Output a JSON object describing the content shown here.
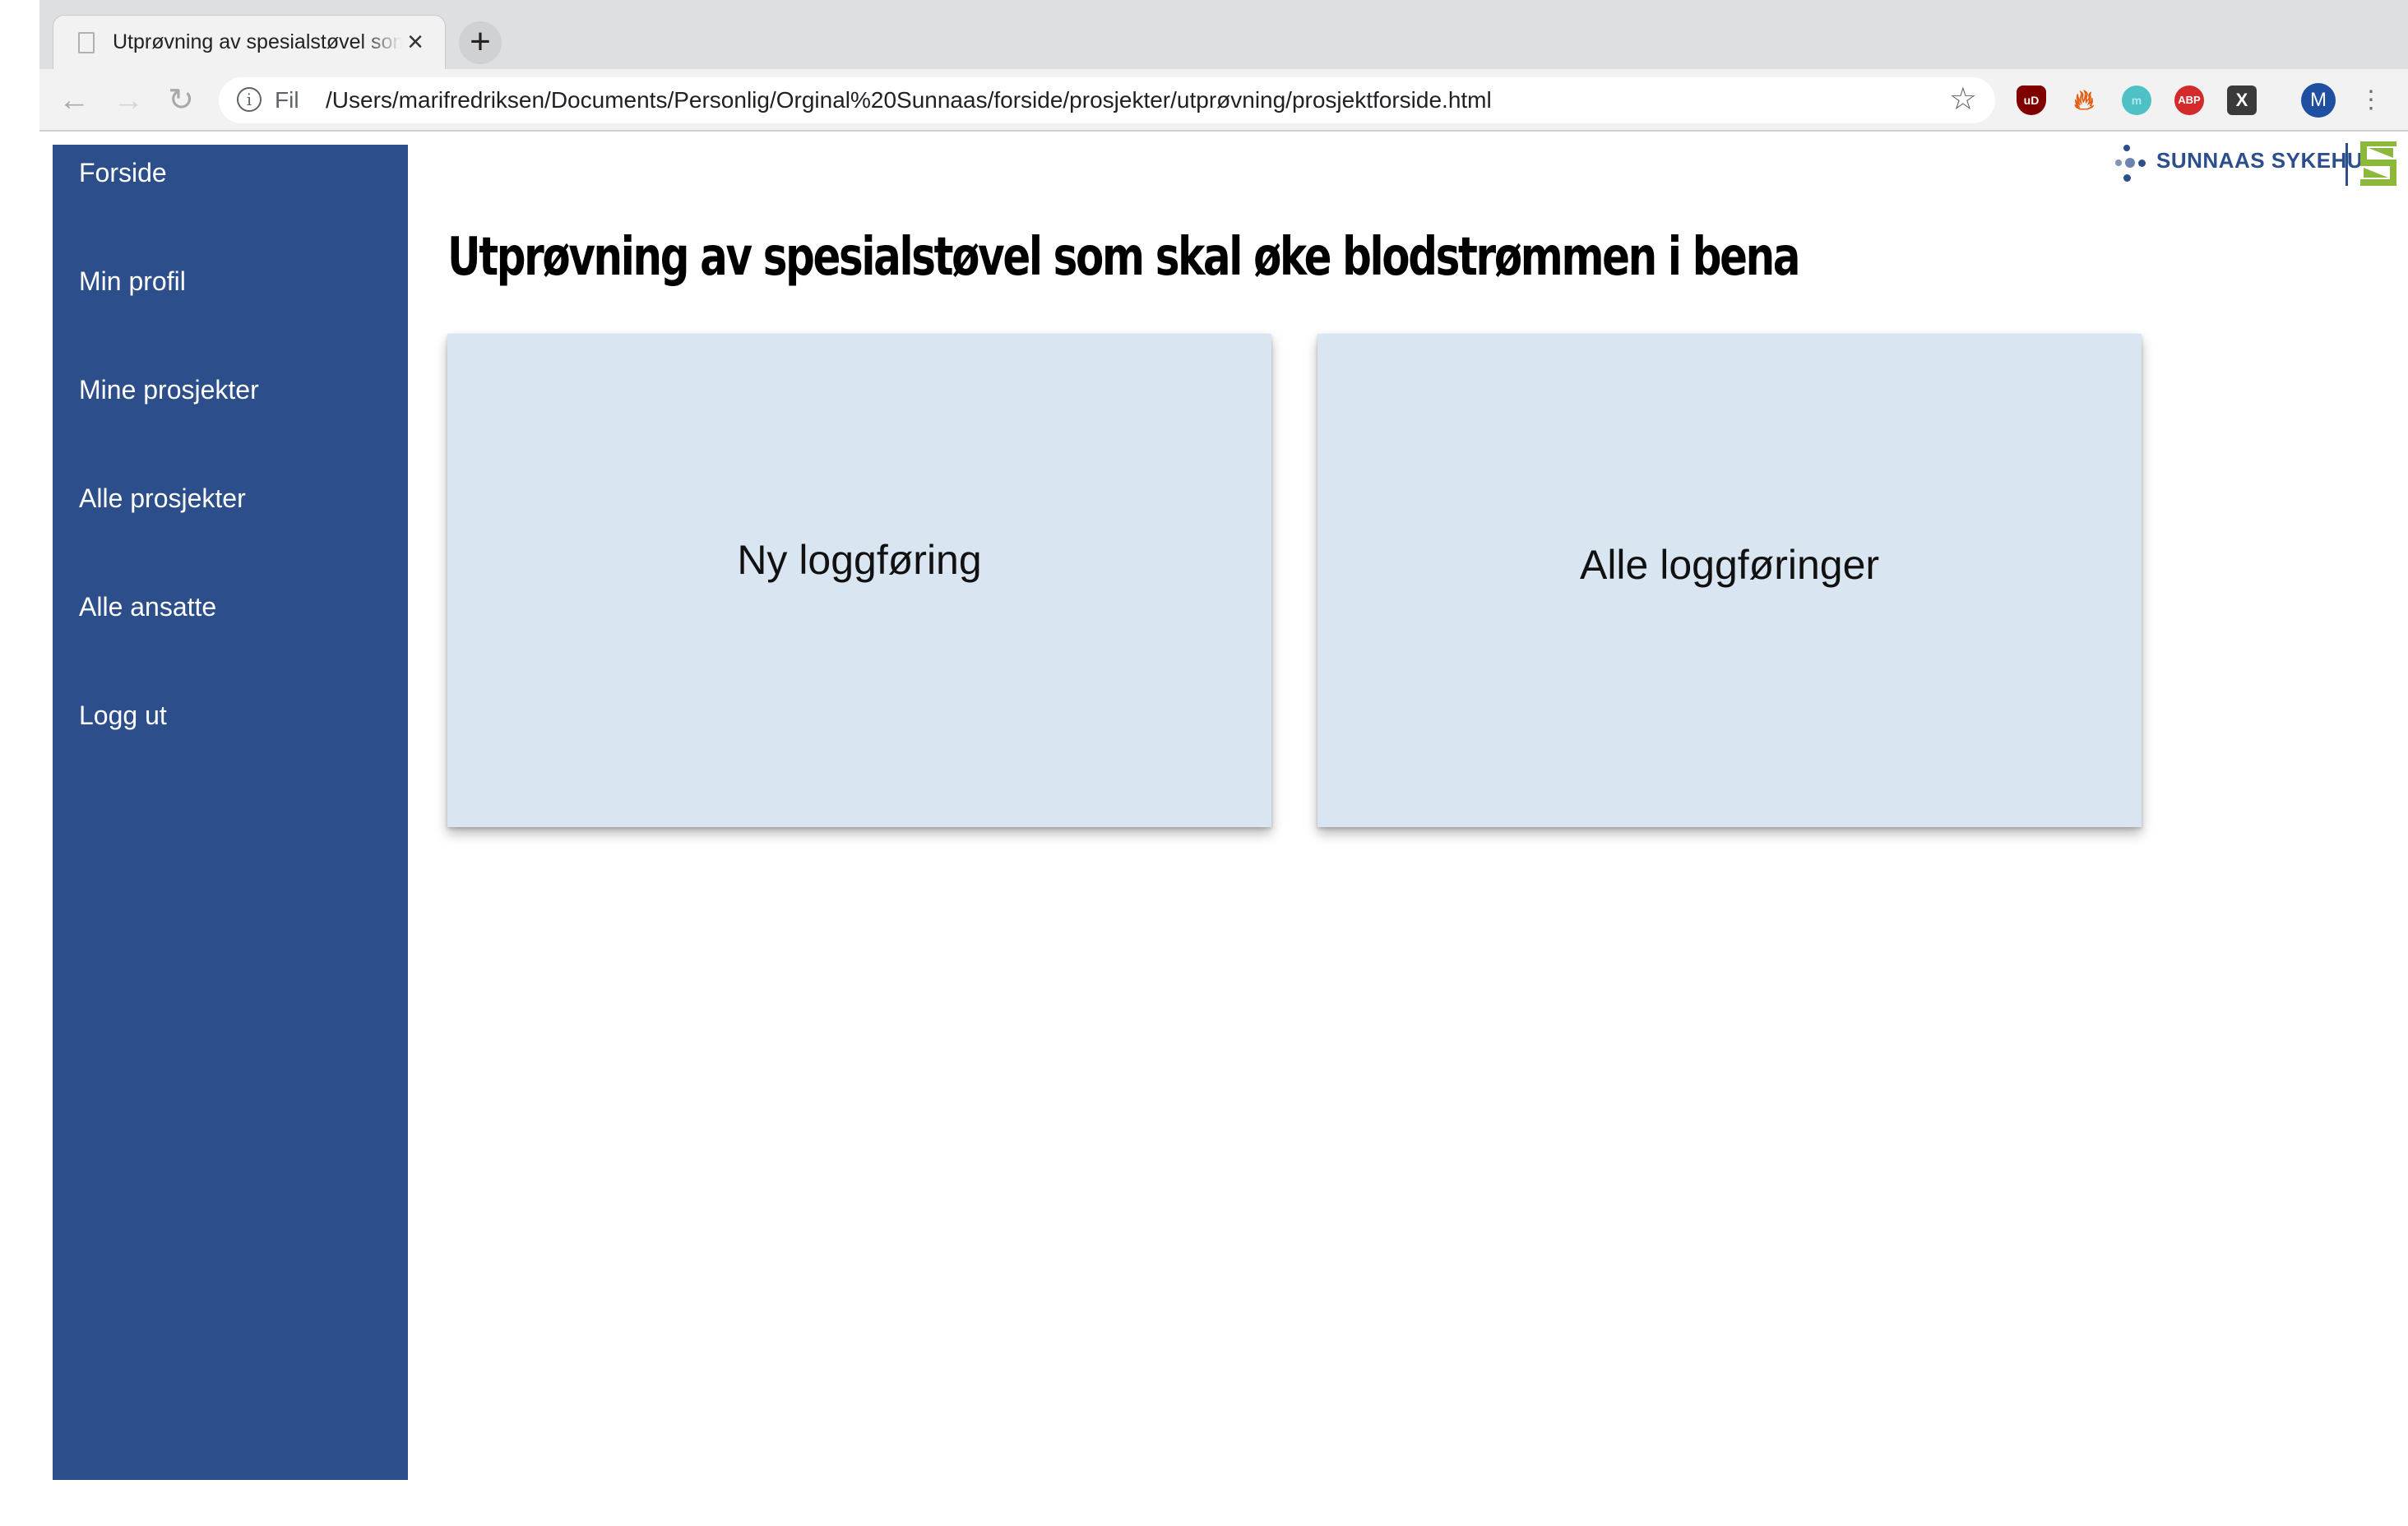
{
  "browser": {
    "tab_title": "Utprøvning av spesialstøvel som skal øke blodstrømmen i bena",
    "scheme_label": "Fil",
    "url": "/Users/marifredriksen/Documents/Personlig/Orginal%20Sunnaas/forside/prosjekter/utprøvning/prosjektforside.html",
    "extensions": [
      "uBlock",
      "flame",
      "mercury",
      "ABP",
      "x"
    ],
    "ublock_label": "uD",
    "mercury_label": "m",
    "abp_label": "ABP",
    "x_label": "X",
    "avatar_letter": "M"
  },
  "sidebar": {
    "items": [
      {
        "label": "Forside"
      },
      {
        "label": "Min profil"
      },
      {
        "label": "Mine prosjekter"
      },
      {
        "label": "Alle prosjekter"
      },
      {
        "label": "Alle ansatte"
      },
      {
        "label": "Logg ut"
      }
    ]
  },
  "logo": {
    "text": "SUNNAAS SYKEHUS"
  },
  "page": {
    "title": "Utprøvning av spesialstøvel som skal øke blodstrømmen i bena",
    "cards": [
      {
        "label": "Ny loggføring"
      },
      {
        "label": "Alle loggføringer"
      }
    ]
  },
  "colors": {
    "sidebar": "#2c4f8c",
    "card": "#dae5f2",
    "logo_green": "#8cb83c"
  }
}
